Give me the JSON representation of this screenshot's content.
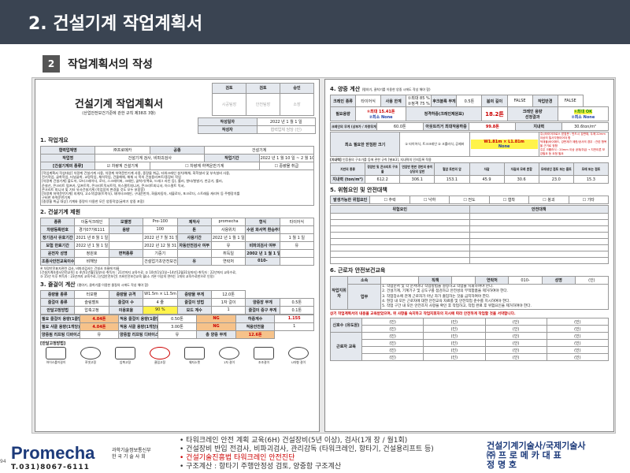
{
  "header": {
    "title": "2. 건설기계 작업계획서"
  },
  "subhead": {
    "num": "2",
    "title": "작업계획서의 작성"
  },
  "left": {
    "approval": {
      "c1": "검토",
      "c2": "검토",
      "c3": "승인",
      "r1": "시공팀장",
      "r2": "안전팀장",
      "r3": "소장"
    },
    "title": "건설기계 작업계획서",
    "subtitle": "(산업안전보건기준에 관한 규칙 제38조 3항)",
    "date_label": "작성일자",
    "date_value": "2022 년   1 월   1 일",
    "writer_label": "작성자",
    "writer_value": "협력업체 담당 (인)",
    "s1": "1. 작업개요",
    "company_label": "협력업체명",
    "company_value": "㈜프로메카",
    "kind_label": "공종",
    "kind_value": "건설기계",
    "work_label": "작업명",
    "work_name": "건설기계 검사, 비파괴검사",
    "period_label": "작업기간",
    "period_value": "2022 년   1 월 10 일 ~ 2 월 10 일",
    "cls_label": "[건설기계의 종류]",
    "cls_opts": [
      "☑ 차량계 건설기계",
      "☐ 차량계 하역운반기계",
      "☐ 중량물 취급"
    ],
    "notes": [
      "[작업계획서 작성대상] 차량계 건설기계 사용, 차량계 하역운반기계 사용, 중량물 취급, 타워크레인 설치/해체, 화학설비 및 부속설비 사용,",
      "전기작업, 굴착작업, 터널굴착, 교량작업, 채석작업, 건물해체, 해체 시 목의 건설용리프트/중장비 작업",
      "[차량계 건설기계] 불도저, 모터그레이더, 로더, 스크레이퍼, 크레인, 굴착기(백호, 드래그 라인 등), 롤러, 항타/항발기, 천공기, 롤러,",
      "준설선, 콘크리트 펌프카, 덤프트럭, 콘크리트믹서트럭, 아스팔트피니셔, 콘크리트피니셔, 아스팔트 믹서,",
      "콘크리트 피니셔 및 기타 유사건설기계 (작업장의 변경을 것도 모두 포함함)",
      "[차량계 하역운반기계] 지게차, 고소작업대(트럭식), 데이터크레인, 구내운반차, 화물자동차, 셔블로더, 포크로더, 스트래들 캐리어 등 주행장치를",
      "구비한 하역운반기계",
      "[중량물 취급 대상] 기계와 중량이 이용한 모든 양중작업(굴착기 양중 포함)"
    ],
    "s2": "2. 건설기계 제원",
    "spec_rows": [
      [
        "종류",
        "이동식크레인",
        "모델명",
        "Pro-100",
        "제작사",
        "promecha",
        "형식",
        "타이어식"
      ],
      [
        "차량등록번호",
        "경기07가6111",
        "용량",
        "100",
        "톤",
        "사용위치",
        "수원 화서역 환승주차장",
        ""
      ],
      [
        "정기검사 유효기간",
        "2021 년   8 월   1 일 ~",
        "",
        "2022 년   7 월 31 일",
        "사용기간",
        "2022 년   1 월   1 일 ~",
        "",
        "1 월   1 일"
      ],
      [
        "보험 만료기간",
        "2022 년   1 월   1 일 ~",
        "",
        "2022 년 12 월 31 일",
        "자동안전검사 여부",
        "유",
        "비파괴검사 여부",
        "유"
      ],
      [
        "운전자 성명",
        "정원호",
        "면허종류",
        "기중기",
        "",
        "취득일",
        "2002 년   1 월   1 일",
        ""
      ],
      [
        "조종사안전교육이수",
        "비해당",
        "",
        "건설업기초안전보건교육",
        "유",
        "연락처",
        "010-",
        ""
      ]
    ],
    "spec_notes": [
      "※ 차량안전표지관련 검사, 비파괴검사는 건설사 자율에 따름",
      "[건설기계조종사안전교육] ① 4년(1년월1일부터) 취득자 : 21년까지 교육수료, ② 10년(1일1일~14년12월31일까지) 취득자 : 22년까지 교육수료,",
      "③ 15년 이후 취득자 : 23년까지 교육수료, [산업안전보건] 기초안전보건교육 월(소 기본 이상의 면허는 1개의 교육수료한으로 인정)"
    ],
    "s3": "3. 줄걸이 계산",
    "s3_hint": "(평야기, 클착기를 이용한 물질의 시에도 작성 해야 함)",
    "rig_rows": [
      [
        "중량물 종류",
        "터보팬",
        "중량물 규격",
        "W1.5m × L1.5m × H1.5m",
        "중량물 무게",
        "12.0톤"
      ],
      [
        "줄걸이 종류",
        "슬링벨트",
        "줄걸이 수",
        "4 줄",
        "줄걸이 방법",
        "1자 걸이",
        "양중장 무게",
        "0.5톤"
      ],
      [
        "안달고정방법",
        "압축고정",
        "이용효율",
        "90 %",
        "모드 계수",
        "1",
        "줄걸이 중구 무게",
        "0.1톤"
      ]
    ],
    "rig_red": [
      [
        "필요 줄걸이 용량(1줄당)",
        "4.04톤",
        "적용 줄걸이 용량(1줄당)",
        "0.50톤",
        "NG",
        "하중계수",
        "1.155"
      ],
      [
        "필요 샤클 용량(1개당)",
        "4.04톤",
        "적용 샤클 용량(1개당)",
        "3.00톤",
        "NG",
        "적용안전율",
        "1"
      ],
      [
        "양중됨 리프팅 디바이스 구조계산",
        "유",
        "양중함 리프팅 디바이스 비파괴검사",
        "유",
        "총 양중 무게",
        "12.6톤"
      ]
    ],
    "icons_label": "[안달고정방법]",
    "icons": [
      "아이스룰이걸이",
      "쪼셋고정",
      "압축고정",
      "클립고정",
      "웨지소켓",
      "1자 걸이",
      "조조걸이",
      "U자형 걸이"
    ]
  },
  "right": {
    "s4": "4. 양중 계산",
    "s4_hint": "(평야기, 클착기를 이용한 양중 시에도 작성 해야 함)",
    "lift_rows": [
      [
        "크레인 종류",
        "타이어식",
        "사용 한계",
        "①최대 85 %",
        "②정격 75 %",
        "후크블록 무게",
        "0.5톤",
        "붐의 길이",
        "FALSE",
        "작업반경",
        "FALSE"
      ],
      [
        "필요용량",
        "①최대 15.41톤",
        "②최소 None",
        "정격하중(크레인제원표)",
        "18.2톤",
        "크레인 용량",
        "①최대 OK",
        "②최소 None"
      ]
    ],
    "lift_note": "선정결과",
    "crane_row": [
      "크레인의 무게 (상부가 / 차량무게)",
      "60.0톤",
      "아웃트리거 최대작용하중",
      "99.8톤",
      "지내력",
      "30.6ton/m²"
    ],
    "mat_row": [
      "최소 필요한 받침판 크기",
      "① 타이어식, 트크크레인 ② 크롤러식, 공제바",
      "W1.81m × L1.81m",
      "None"
    ],
    "mat_note": [
      "주)(타이어크로스 받침판 : 반드시 강판재, 두께 22mm이상의 철사각형이어야 함",
      "적재물(바이애드, 강판재가 제한/공사의 경우 : 관련 항목을 근거로 정함",
      "주은 크롤러식 : 20mm 이상 공재/취급 → 지반이론 보강필요 등 요청 필요"
    ],
    "soil_label": "[지내력]",
    "soil_hint": "인증물의 구조가를 등에 관한 규칙 [별표3], 지내력의 인지등록 적용",
    "soil_headers": [
      "지반의 종류",
      "경암반 및 콘크리트 구조물",
      "연암반 편판 경반의 층이 상당의 암반",
      "혈암 토반의 암",
      "자갈",
      "자갈과 모래 혼합",
      "모래섞인 점토 또는 롬토",
      "모래 또는 점토"
    ],
    "soil_values": [
      "지내력 (ton/m²)",
      "612.2",
      "306.1",
      "153.1",
      "45.9",
      "30.6",
      "23.0",
      "15.3"
    ],
    "s5": "5. 위험요인 및 안전대책",
    "risk_types": [
      "발생가능한 위험요인",
      "☐ 추락",
      "☐ 낙하",
      "☐ 전도",
      "☐ 협착",
      "☐ 붕괴",
      "☐ 기타"
    ],
    "risk_cols": [
      "위험요인",
      "안전대책"
    ],
    "s6": "6. 근로자 안전보건교육",
    "edu_head": [
      "소속",
      "직책",
      "연락처",
      "010-",
      "성명",
      "(인)"
    ],
    "edu_items": [
      "1. 작업순서 및 각 순서마다 작업방법을 결정하고 작업을 지휘하여야 한다.",
      "2. 건설기계, 기계기구 및 공도구를 점검하고 안전성의 부적합품을 제거하여야 한다.",
      "3. 작업장소에 관계 근로자가 아닌 자가 출입하는 것을 금지하여야 한다.",
      "4. 현장 내 모든 근로자에 대한 안전교육 자료를 및 안전작업 준수를 지시하여야 한다.",
      "5. 작업 구간 내 모든 안전조치 사항을 확인 후 작업하고, 작업 완료 후 위험요인을 제거하여야 한다."
    ],
    "edu_side": "업무",
    "edu_vertical": "작업지휘자",
    "edu_warn": "상기 작업계획서의 내용을 교육받았으며, 위 사항을 숙지하고 작업지휘자의 지시에 따라 안전하게 작업할 것을 서약합니다.",
    "sign_labels": [
      "신호수 (유도원)",
      "근로자 교육"
    ],
    "sign_mark": "(인)"
  },
  "footer": {
    "logo": "Promecha",
    "tel": "T.031)8067-6111",
    "inst": [
      "과학기술정보통신부",
      "한 국 기 술 사 회"
    ],
    "bullets": [
      "• 타워크레인 안전 계획 교육(6H) 건설장비(5년 이상), 검사(1개 장 / 월1회)",
      "• 건설장비 반입 전검사, 비파괴검사, 관리감독 (타워크레인, 항타기, 건설용리프트 등)",
      "• 건설기술진흥법 타워크레인 안전진단",
      "• 구조계산 : 항타기 주행안정성 검토, 양중함 구조계산"
    ],
    "brand": [
      "건설기계기술사/국제기술사",
      "㈜ 프 로 메 카  대 표",
      "정          명          호"
    ],
    "page_num": "94"
  }
}
